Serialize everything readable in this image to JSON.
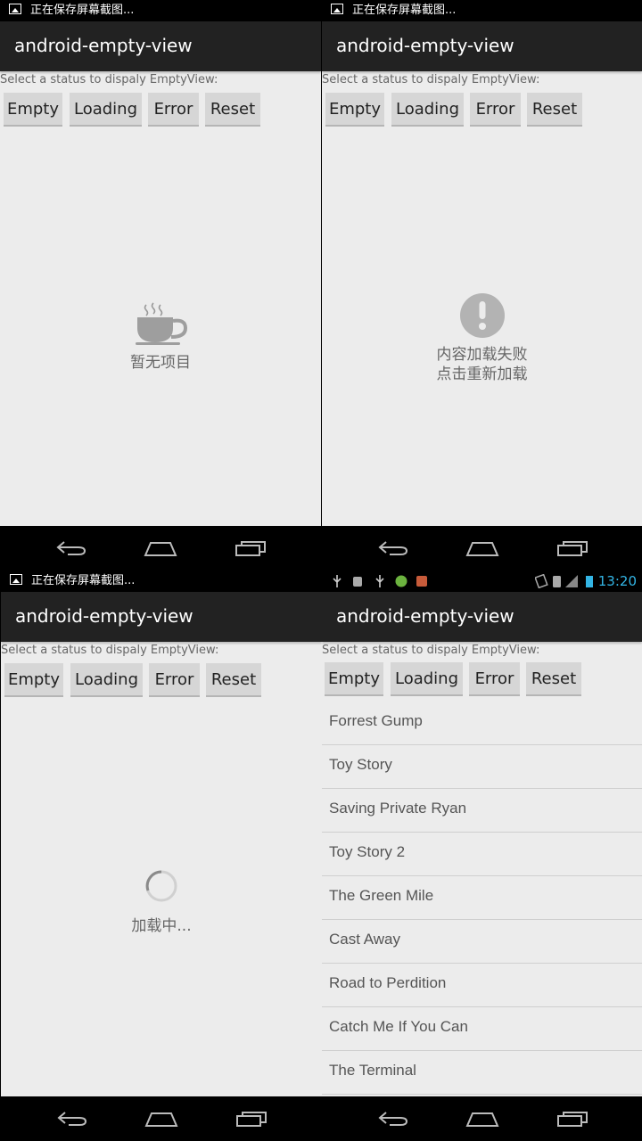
{
  "status_text": "正在保存屏幕截图...",
  "app_title": "android-empty-view",
  "prompt": "Select a status to dispaly EmptyView:",
  "buttons": {
    "empty": "Empty",
    "loading": "Loading",
    "error": "Error",
    "reset": "Reset"
  },
  "empty_state": {
    "message": "暂无项目",
    "icon": "coffee-cup-icon"
  },
  "error_state": {
    "line1": "内容加载失败",
    "line2": "点击重新加载",
    "icon": "exclamation-icon"
  },
  "loading_state": {
    "message": "加载中...",
    "icon": "spinner-icon"
  },
  "list_panel": {
    "time": "13:20"
  },
  "movies": [
    "Forrest Gump",
    "Toy Story",
    "Saving Private Ryan",
    "Toy Story 2",
    "The Green Mile",
    "Cast Away",
    "Road to Perdition",
    "Catch Me If You Can",
    "The Terminal"
  ],
  "colors": {
    "accent": "#33b5e5",
    "action_bar": "#222222",
    "background": "#ececec"
  }
}
